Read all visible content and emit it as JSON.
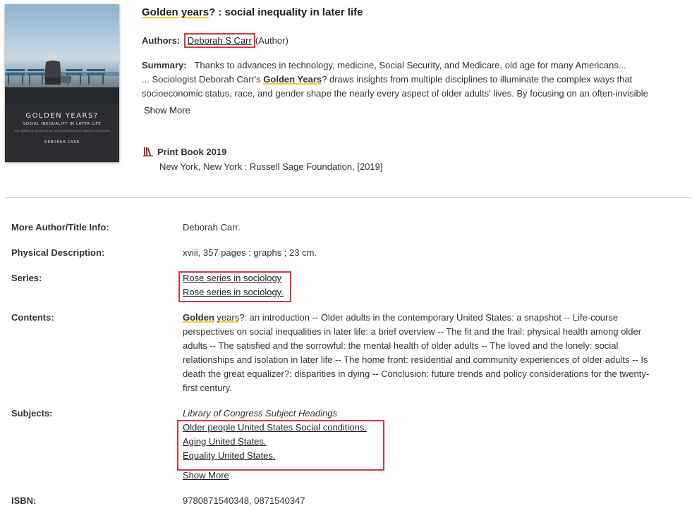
{
  "record": {
    "title_hl_1": "Golden",
    "title_hl_2": "years",
    "title_rest": "? : social inequality in later life",
    "authors_label": "Authors:",
    "author_name": "Deborah S Carr",
    "author_role": "(Author)",
    "summary_label": "Summary:",
    "summary_line1": "Thanks to advances in technology, medicine, Social Security, and Medicare, old age for many Americans...",
    "summary_line2_pre": "... Sociologist Deborah Carr's ",
    "summary_line2_hl": "Golden Years",
    "summary_line2_post": "? draws insights from multiple disciplines to illuminate the complex ways that",
    "summary_line3": "socioeconomic status, race, and gender shape the nearly every aspect of older adults' lives. By focusing on an often-invisible",
    "show_more": "Show More",
    "format": "Print Book 2019",
    "publisher": "New York, New York : Russell Sage Foundation, [2019]"
  },
  "cover": {
    "title": "GOLDEN YEARS?",
    "subtitle": "SOCIAL INEQUALITY IN LATER LIFE",
    "series_note": "THE AMERICAN SOCIOLOGICAL ASSOCIATION'S ROSE SERIES IN SOCIOLOGY",
    "author": "DEBORAH CARR"
  },
  "details": {
    "more_author_label": "More Author/Title Info:",
    "more_author_value": "Deborah Carr.",
    "physical_label": "Physical Description:",
    "physical_value": "xviii, 357 pages : graphs ; 23 cm.",
    "series_label": "Series:",
    "series": [
      "Rose series in sociology",
      "Rose series in sociology."
    ],
    "contents_label": "Contents:",
    "contents_hl_1": "Golden",
    "contents_hl_2": "years",
    "contents_lines": [
      "?: an introduction -- Older adults in the contemporary United States: a snapshot -- Life-course",
      "perspectives on social inequalities in later life: a brief overview -- The fit and the frail: physical health among older",
      "adults -- The satisfied and the sorrowful: the mental health of older adults -- The loved and the lonely: social",
      "relationships and isolation in later life -- The home front: residential and community experiences of older adults -- Is",
      "death the great equalizer?: disparities in dying -- Conclusion: future trends and policy considerations for the twenty-",
      "first century."
    ],
    "subjects_label": "Subjects:",
    "subjects_heading": "Library of Congress Subject Headings",
    "subjects": [
      "Older people United States Social conditions.",
      "Aging United States.",
      "Equality United States."
    ],
    "subjects_show_more": "Show More",
    "isbn_label": "ISBN:",
    "isbn_value": "9780871540348, 0871540347"
  },
  "colors": {
    "highlight": "#f5d229",
    "box_outline": "#d9363e",
    "book_icon": "#a0303a"
  }
}
